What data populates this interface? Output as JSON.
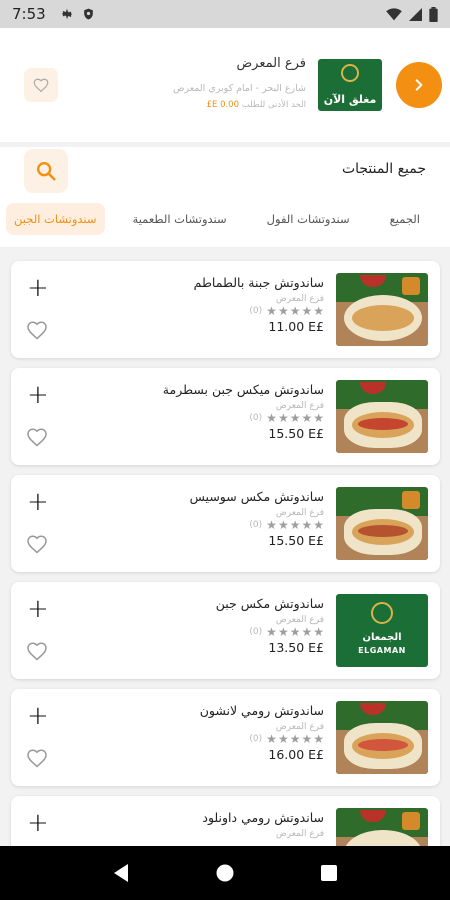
{
  "status_bar": {
    "time": "7:53",
    "icons": [
      "gear-icon",
      "shield-icon",
      "wifi-icon",
      "signal-icon",
      "battery-icon"
    ]
  },
  "branch": {
    "name": "فرع المعرض",
    "address": "شارع البحر - امام كوبري المعرض",
    "min_order_label": "الحد الأدنى للطلب",
    "min_order_value": "0.00 E£",
    "status_label": "مغلق الآن"
  },
  "products": {
    "title": "جميع المنتجات",
    "tabs": [
      {
        "label": "الجميع",
        "active": false
      },
      {
        "label": "سندوتشات الفول",
        "active": false
      },
      {
        "label": "سندوتشات الطعمية",
        "active": false
      },
      {
        "label": "سندوتشات الجبن",
        "active": true
      }
    ],
    "items": [
      {
        "name": "ساندوتش جبنة بالطماطم",
        "branch": "فرع المعرض",
        "rating_count": "(0)",
        "price": "11.00 E£",
        "image": "food-photo"
      },
      {
        "name": "ساندوتش ميكس جبن بسطرمة",
        "branch": "فرع المعرض",
        "rating_count": "(0)",
        "price": "15.50 E£",
        "image": "food-photo"
      },
      {
        "name": "ساندوتش مكس سوسيس",
        "branch": "فرع المعرض",
        "rating_count": "(0)",
        "price": "15.50 E£",
        "image": "food-photo"
      },
      {
        "name": "ساندوتش مكس جبن",
        "branch": "فرع المعرض",
        "rating_count": "(0)",
        "price": "13.50 E£",
        "image": "brand-logo",
        "logo_text_ar": "الجمعان",
        "logo_text_en": "ELGAMAN"
      },
      {
        "name": "ساندوتش رومي لانشون",
        "branch": "فرع المعرض",
        "rating_count": "(0)",
        "price": "16.00 E£",
        "image": "food-photo"
      },
      {
        "name": "ساندوتش رومي داونلود",
        "branch": "فرع المعرض",
        "rating_count": "",
        "price": "",
        "image": "food-photo"
      }
    ]
  },
  "colors": {
    "accent": "#f39012",
    "accent_light": "#fdeee0",
    "brand_green": "#1b6e36",
    "star": "#9e9e9e"
  }
}
